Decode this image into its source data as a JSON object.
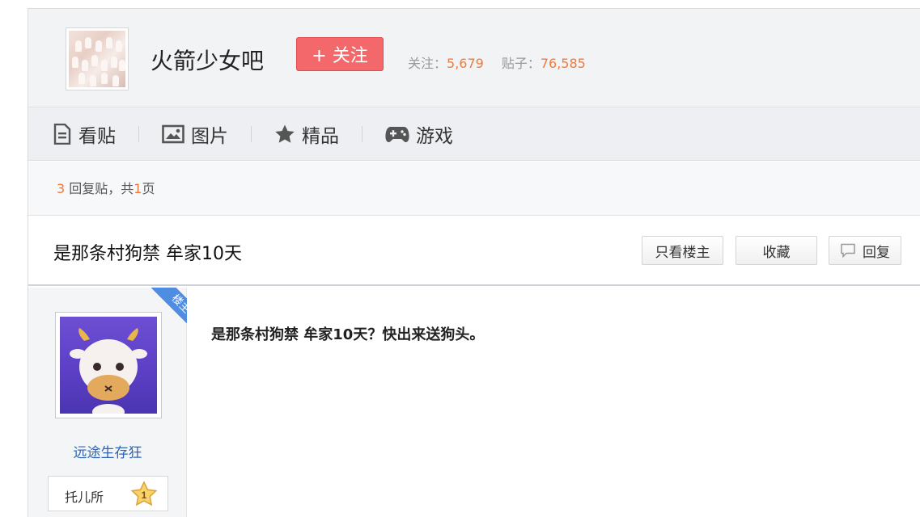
{
  "forum": {
    "name": "火箭少女吧",
    "follow_label": "+ 关注",
    "follow_count_label": "关注：",
    "follow_count": "5,679",
    "post_count_label": "贴子：",
    "post_count": "76,585"
  },
  "tabs": [
    {
      "label": "看贴",
      "icon": "document-icon"
    },
    {
      "label": "图片",
      "icon": "image-icon"
    },
    {
      "label": "精品",
      "icon": "star-icon"
    },
    {
      "label": "游戏",
      "icon": "gamepad-icon"
    }
  ],
  "reply_info": {
    "count": "3",
    "count_suffix": " 回复贴，共",
    "pages": "1",
    "pages_suffix": "页"
  },
  "thread": {
    "title": "是那条村狗禁 牟家10天",
    "only_op_label": "只看楼主",
    "favorite_label": "收藏",
    "reply_label": "回复"
  },
  "post": {
    "op_badge": "楼主",
    "username": "远途生存狂",
    "level_name": "托儿所",
    "level_number": "1",
    "content": "是那条村狗禁 牟家10天？快出来送狗头。"
  },
  "colors": {
    "accent_orange": "#f07a3b",
    "follow_red": "#f3686a",
    "op_ribbon_blue": "#4f8de2",
    "username_blue": "#2d64b3"
  }
}
